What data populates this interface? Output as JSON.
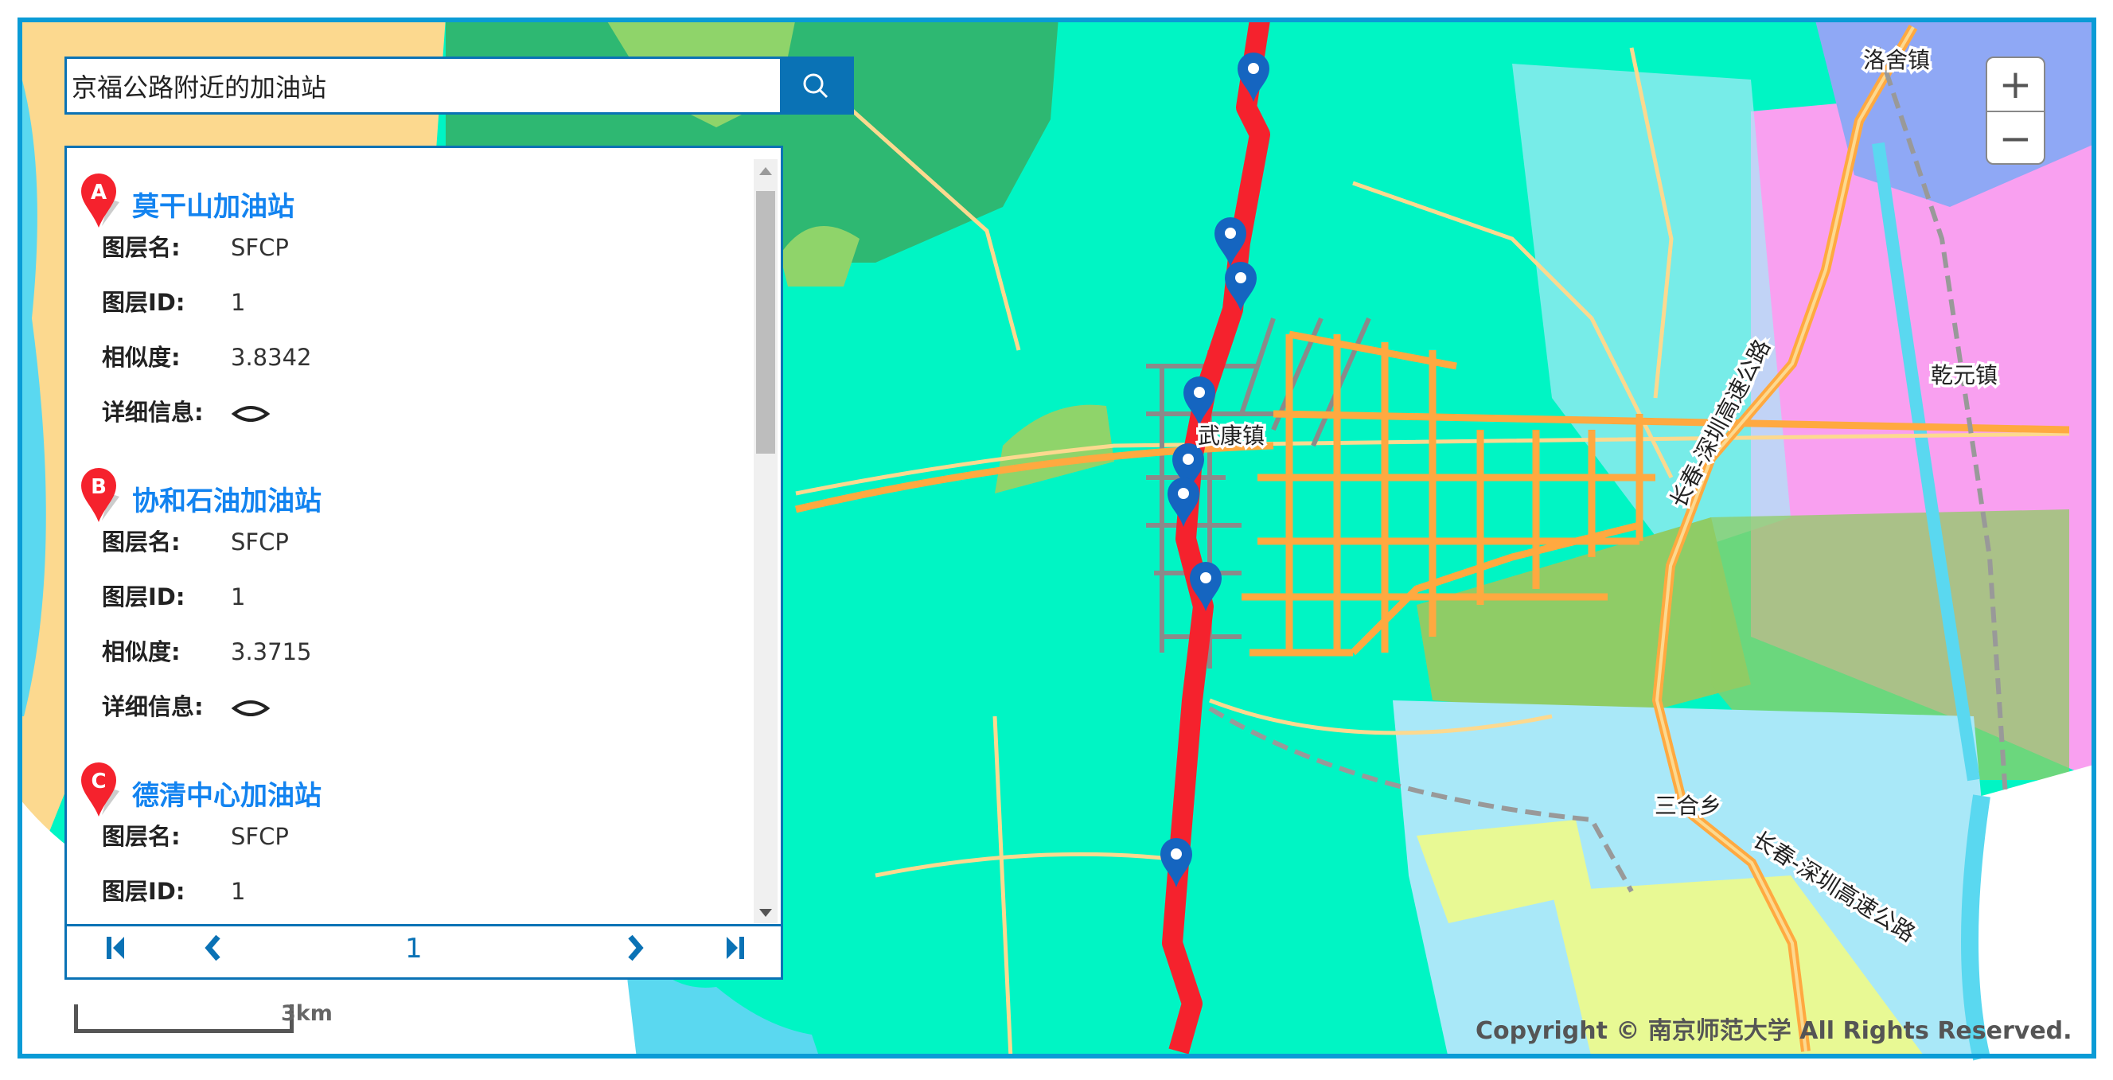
{
  "search": {
    "value": "京福公路附近的加油站",
    "button": "search-icon"
  },
  "results": [
    {
      "marker": "A",
      "name": "莫干山加油站",
      "fields": [
        {
          "label": "图层名:",
          "value": "SFCP"
        },
        {
          "label": "图层ID:",
          "value": "1"
        },
        {
          "label": "相似度:",
          "value": "3.8342"
        },
        {
          "label": "详细信息:",
          "value": ""
        }
      ]
    },
    {
      "marker": "B",
      "name": "协和石油加油站",
      "fields": [
        {
          "label": "图层名:",
          "value": "SFCP"
        },
        {
          "label": "图层ID:",
          "value": "1"
        },
        {
          "label": "相似度:",
          "value": "3.3715"
        },
        {
          "label": "详细信息:",
          "value": ""
        }
      ]
    },
    {
      "marker": "C",
      "name": "德清中心加油站",
      "fields": [
        {
          "label": "图层名:",
          "value": "SFCP"
        },
        {
          "label": "图层ID:",
          "value": "1"
        }
      ]
    }
  ],
  "pager": {
    "first": "first-page-icon",
    "prev": "prev-page-icon",
    "page": "1",
    "next": "next-page-icon",
    "last": "last-page-icon"
  },
  "zoom": {
    "in": "+",
    "out": "−"
  },
  "map": {
    "labels": {
      "luoshe": "洛舍镇",
      "qianyuan": "乾元镇",
      "wukang": "武康镇",
      "sanhe": "三合乡",
      "highway1": "长春-深圳高速公路",
      "highway2": "长春-深圳高速公路"
    },
    "scale": "3km",
    "copyright": "Copyright © 南京师范大学  All Rights Reserved."
  },
  "colors": {
    "accent": "#0a72b5",
    "route": "#f5222d",
    "marker": "#1565c0",
    "title": "#1283f0"
  }
}
